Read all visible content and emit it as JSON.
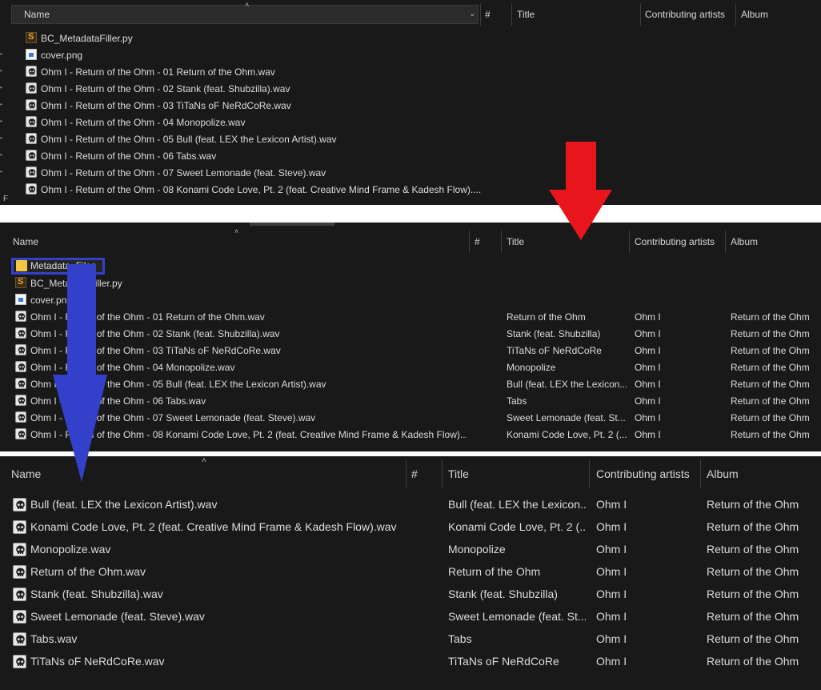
{
  "panel1": {
    "columns": {
      "name": "Name",
      "num": "#",
      "title": "Title",
      "artists": "Contributing artists",
      "album": "Album"
    },
    "files": [
      {
        "name": "BC_MetadataFiller.py",
        "icon": "python-file-icon"
      },
      {
        "name": "cover.png",
        "icon": "image-file-icon"
      },
      {
        "name": "Ohm I - Return of the Ohm - 01 Return of the Ohm.wav",
        "icon": "wav-file-icon"
      },
      {
        "name": "Ohm I - Return of the Ohm - 02 Stank (feat. Shubzilla).wav",
        "icon": "wav-file-icon"
      },
      {
        "name": "Ohm I - Return of the Ohm - 03 TiTaNs oF NeRdCoRe.wav",
        "icon": "wav-file-icon"
      },
      {
        "name": "Ohm I - Return of the Ohm - 04 Monopolize.wav",
        "icon": "wav-file-icon"
      },
      {
        "name": "Ohm I - Return of the Ohm - 05 Bull (feat. LEX the Lexicon Artist).wav",
        "icon": "wav-file-icon"
      },
      {
        "name": "Ohm I - Return of the Ohm - 06 Tabs.wav",
        "icon": "wav-file-icon"
      },
      {
        "name": "Ohm I - Return of the Ohm - 07 Sweet Lemonade (feat. Steve).wav",
        "icon": "wav-file-icon"
      },
      {
        "name": "Ohm I - Return of the Ohm - 08 Konami Code Love, Pt. 2 (feat. Creative Mind Frame & Kadesh Flow)....",
        "icon": "wav-file-icon"
      }
    ]
  },
  "panel2": {
    "columns": {
      "name": "Name",
      "num": "#",
      "title": "Title",
      "artists": "Contributing artists",
      "album": "Album"
    },
    "folder": "Metadata_Files",
    "files": [
      {
        "name": "BC_MetadataFiller.py",
        "icon": "python-file-icon",
        "title": "",
        "artist": "",
        "album": ""
      },
      {
        "name": "cover.png",
        "icon": "image-file-icon",
        "title": "",
        "artist": "",
        "album": ""
      },
      {
        "name": "Ohm I - Return of the Ohm - 01 Return of the Ohm.wav",
        "icon": "wav-file-icon",
        "title": "Return of the Ohm",
        "artist": "Ohm I",
        "album": "Return of the Ohm"
      },
      {
        "name": "Ohm I - Return of the Ohm - 02 Stank (feat. Shubzilla).wav",
        "icon": "wav-file-icon",
        "title": "Stank (feat. Shubzilla)",
        "artist": "Ohm I",
        "album": "Return of the Ohm"
      },
      {
        "name": "Ohm I - Return of the Ohm - 03 TiTaNs oF NeRdCoRe.wav",
        "icon": "wav-file-icon",
        "title": "TiTaNs oF NeRdCoRe",
        "artist": "Ohm I",
        "album": "Return of the Ohm"
      },
      {
        "name": "Ohm I - Return of the Ohm - 04 Monopolize.wav",
        "icon": "wav-file-icon",
        "title": "Monopolize",
        "artist": "Ohm I",
        "album": "Return of the Ohm"
      },
      {
        "name": "Ohm I - Return of the Ohm - 05 Bull (feat. LEX the Lexicon Artist).wav",
        "icon": "wav-file-icon",
        "title": "Bull (feat. LEX the Lexicon...",
        "artist": "Ohm I",
        "album": "Return of the Ohm"
      },
      {
        "name": "Ohm I - Return of the Ohm - 06 Tabs.wav",
        "icon": "wav-file-icon",
        "title": "Tabs",
        "artist": "Ohm I",
        "album": "Return of the Ohm"
      },
      {
        "name": "Ohm I - Return of the Ohm - 07 Sweet Lemonade (feat. Steve).wav",
        "icon": "wav-file-icon",
        "title": "Sweet Lemonade (feat. St...",
        "artist": "Ohm I",
        "album": "Return of the Ohm"
      },
      {
        "name": "Ohm I - Return of the Ohm - 08 Konami Code Love, Pt. 2 (feat. Creative Mind Frame & Kadesh Flow)....",
        "icon": "wav-file-icon",
        "title": "Konami Code Love, Pt. 2 (...",
        "artist": "Ohm I",
        "album": "Return of the Ohm"
      }
    ]
  },
  "panel3": {
    "columns": {
      "name": "Name",
      "num": "#",
      "title": "Title",
      "artists": "Contributing artists",
      "album": "Album"
    },
    "files": [
      {
        "name": "Bull (feat. LEX the Lexicon Artist).wav",
        "title": "Bull (feat. LEX the Lexicon...",
        "artist": "Ohm I",
        "album": "Return of the Ohm"
      },
      {
        "name": "Konami Code Love, Pt. 2 (feat. Creative Mind Frame & Kadesh Flow).wav",
        "title": "Konami Code Love, Pt. 2 (...",
        "artist": "Ohm I",
        "album": "Return of the Ohm"
      },
      {
        "name": "Monopolize.wav",
        "title": "Monopolize",
        "artist": "Ohm I",
        "album": "Return of the Ohm"
      },
      {
        "name": "Return of the Ohm.wav",
        "title": "Return of the Ohm",
        "artist": "Ohm I",
        "album": "Return of the Ohm"
      },
      {
        "name": "Stank (feat. Shubzilla).wav",
        "title": "Stank (feat. Shubzilla)",
        "artist": "Ohm I",
        "album": "Return of the Ohm"
      },
      {
        "name": "Sweet Lemonade (feat. Steve).wav",
        "title": "Sweet Lemonade (feat. St...",
        "artist": "Ohm I",
        "album": "Return of the Ohm"
      },
      {
        "name": "Tabs.wav",
        "title": "Tabs",
        "artist": "Ohm I",
        "album": "Return of the Ohm"
      },
      {
        "name": "TiTaNs oF NeRdCoRe.wav",
        "title": "TiTaNs oF NeRdCoRe",
        "artist": "Ohm I",
        "album": "Return of the Ohm"
      }
    ]
  },
  "colors": {
    "panel_bg": "#191919",
    "red_arrow": "#e8161c",
    "blue_arrow": "#3340c9",
    "folder_yellow": "#f2c744"
  }
}
